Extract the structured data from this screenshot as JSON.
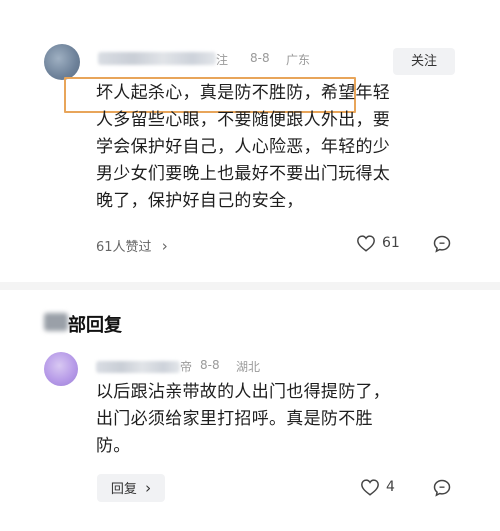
{
  "comment": {
    "author_suffix": "注",
    "date": "8-8",
    "location": "广东",
    "follow_label": "关注",
    "highlighted_text": "坏人起杀心，真是防不胜防，",
    "lines": [
      "希望年轻",
      "人多留些心眼，不要随便跟人外出，要",
      "学会保护好自己，人心险恶，年轻的少",
      "男少女们要晚上也最好不要出门玩得太",
      "晚了，保护好自己的安全，"
    ],
    "likes_label": "61人赞过",
    "likes_chevron": "›",
    "comment_count": "61",
    "like_icon": "heart-outline-icon",
    "comment_icon": "comment-bubble-icon"
  },
  "section": {
    "title_visible": "部回复"
  },
  "reply": {
    "author_suffix": "帝",
    "date": "8-8",
    "location": "湖北",
    "lines": [
      "以后跟沾亲带故的人出门也得提防了，",
      "出门必须给家里打招呼。真是防不胜",
      "防。"
    ],
    "reply_label": "回复",
    "reply_chevron": "›",
    "comment_count": "4",
    "highlight_color": "#e8a55a"
  }
}
